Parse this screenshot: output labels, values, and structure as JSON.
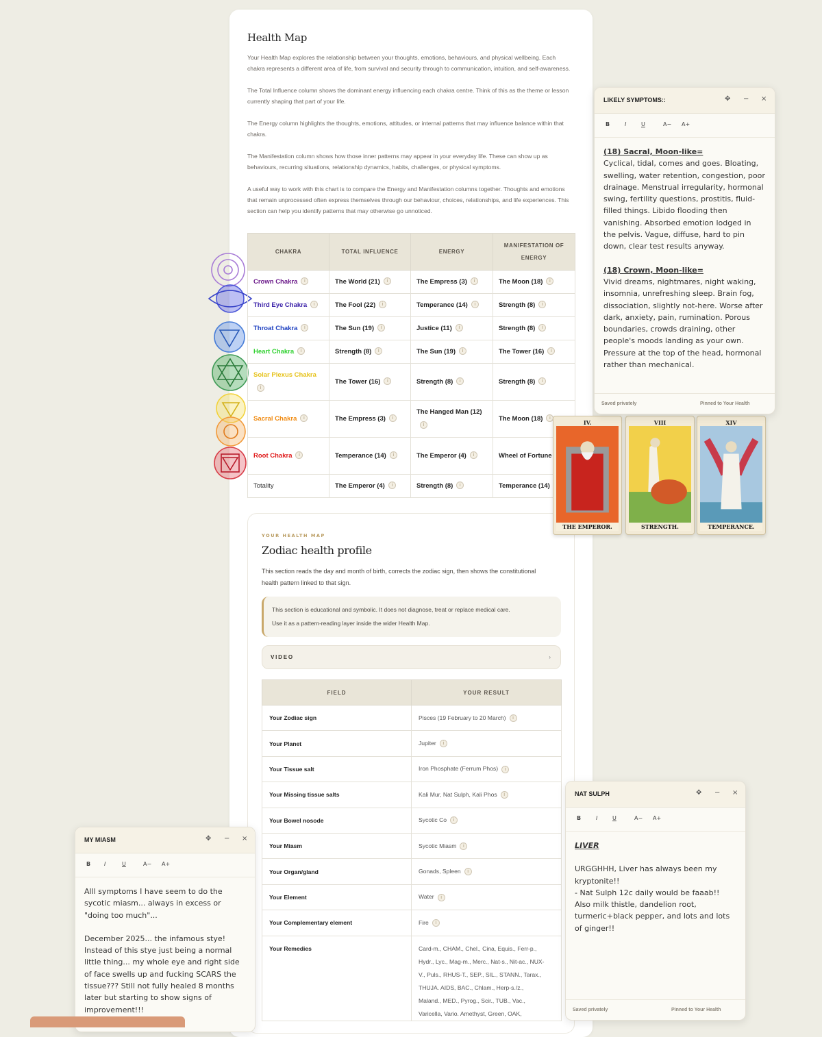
{
  "health_map": {
    "title": "Health Map",
    "paragraphs": [
      "Your Health Map explores the relationship between your thoughts, emotions, behaviours, and physical wellbeing. Each chakra represents a different area of life, from survival and security through to communication, intuition, and self-awareness.",
      "The Total Influence column shows the dominant energy influencing each chakra centre. Think of this as the theme or lesson currently shaping that part of your life.",
      "The Energy column highlights the thoughts, emotions, attitudes, or internal patterns that may influence balance within that chakra.",
      "The Manifestation column shows how those inner patterns may appear in your everyday life. These can show up as behaviours, recurring situations, relationship dynamics, habits, challenges, or physical symptoms.",
      "A useful way to work with this chart is to compare the Energy and Manifestation columns together. Thoughts and emotions that remain unprocessed often express themselves through our behaviour, choices, relationships, and life experiences. This section can help you identify patterns that may otherwise go unnoticed."
    ]
  },
  "chakra_table": {
    "headers": [
      "CHAKRA",
      "TOTAL INFLUENCE",
      "ENERGY",
      "MANIFESTATION OF ENERGY"
    ],
    "rows": [
      {
        "chakra": "Crown Chakra",
        "color": "#6b1a8a",
        "total": "The World (21)",
        "energy": "The Empress (3)",
        "manifestation": "The Moon (18)"
      },
      {
        "chakra": "Third Eye Chakra",
        "color": "#3a20a8",
        "total": "The Fool (22)",
        "energy": "Temperance (14)",
        "manifestation": "Strength (8)"
      },
      {
        "chakra": "Throat Chakra",
        "color": "#1c3fc0",
        "total": "The Sun (19)",
        "energy": "Justice (11)",
        "manifestation": "Strength (8)"
      },
      {
        "chakra": "Heart Chakra",
        "color": "#2fd12f",
        "total": "Strength (8)",
        "energy": "The Sun (19)",
        "manifestation": "The Tower (16)"
      },
      {
        "chakra": "Solar Plexus Chakra",
        "color": "#e6c21a",
        "total": "The Tower (16)",
        "energy": "Strength (8)",
        "manifestation": "Strength (8)"
      },
      {
        "chakra": "Sacral Chakra",
        "color": "#f08a10",
        "total": "The Empress (3)",
        "energy": "The Hanged Man (12)",
        "manifestation": "The Moon (18)"
      },
      {
        "chakra": "Root Chakra",
        "color": "#e01a1a",
        "total": "Temperance (14)",
        "energy": "The Emperor (4)",
        "manifestation": "Wheel of Fortune"
      },
      {
        "chakra": "Totality",
        "color": "#333333",
        "total": "The Emperor (4)",
        "energy": "Strength (8)",
        "manifestation": "Temperance (14)"
      }
    ]
  },
  "chakra_icon_colors": [
    "#a77bd6",
    "#4a55d8",
    "#4a7fd8",
    "#3e9a55",
    "#f2d23a",
    "#f29a3a",
    "#d8404a"
  ],
  "zodiac": {
    "kicker": "YOUR HEALTH MAP",
    "title": "Zodiac health profile",
    "description": "This section reads the day and month of birth, corrects the zodiac sign, then shows the constitutional health pattern linked to that sign.",
    "note_line1": "This section is educational and symbolic. It does not diagnose, treat or replace medical care.",
    "note_line2": "Use it as a pattern-reading layer inside the wider Health Map.",
    "video_label": "VIDEO",
    "table_headers": [
      "FIELD",
      "YOUR RESULT"
    ],
    "rows": [
      {
        "field": "Your Zodiac sign",
        "result": "Pisces (19 February to 20 March)"
      },
      {
        "field": "Your Planet",
        "result": "Jupiter"
      },
      {
        "field": "Your Tissue salt",
        "result": "Iron Phosphate (Ferrum Phos)"
      },
      {
        "field": "Your Missing tissue salts",
        "result": "Kali Mur, Nat Sulph, Kali Phos"
      },
      {
        "field": "Your Bowel nosode",
        "result": "Sycotic Co"
      },
      {
        "field": "Your Miasm",
        "result": "Sycotic Miasm"
      },
      {
        "field": "Your Organ/gland",
        "result": "Gonads, Spleen"
      },
      {
        "field": "Your Element",
        "result": "Water"
      },
      {
        "field": "Your Complementary element",
        "result": "Fire"
      }
    ],
    "remedies_field": "Your Remedies",
    "remedies_lines": [
      "Card-m., CHAM., Chel., Cina, Equis., Ferr-p.,",
      "Hydr., Lyc., Mag-m., Merc., Nat-s., Nit-ac., NUX-",
      "V., Puls., RHUS-T., SEP., SIL., STANN., Tarax.,",
      "THUJA. AIDS, BAC., Chlam., Herp-s./z.,",
      "Maland., MED., Pyrog., Scir., TUB., Vac.,",
      "Varicella, Vario. Amethyst, Green, OAK,"
    ]
  },
  "symptoms_note": {
    "title": "LIKELY SYMPTOMS::",
    "toolbar": {
      "bold": "B",
      "italic": "I",
      "underline": "U",
      "smaller": "A−",
      "larger": "A+"
    },
    "heading1": "(18) Sacral, Moon-like=",
    "text1": "Cyclical, tidal, comes and goes. Bloating, swelling, water retention, congestion, poor drainage. Menstrual irregularity, hormonal swing, fertility questions, prostitis, fluid-filled things. Libido flooding then vanishing. Absorbed emotion lodged in the pelvis. Vague, diffuse, hard to pin down, clear test results anyway.",
    "heading2": "(18) Crown, Moon-like=",
    "text2": "Vivid dreams, nightmares, night waking, insomnia, unrefreshing sleep. Brain fog, dissociation, slightly not-here. Worse after dark, anxiety, pain, rumination. Porous boundaries, crowds draining, other people's moods landing as your own. Pressure at the top of the head, hormonal rather than mechanical.",
    "footer_left": "Saved privately",
    "footer_right": "Pinned to Your Health"
  },
  "miasm_note": {
    "title": "MY MIASM",
    "toolbar": {
      "bold": "B",
      "italic": "I",
      "underline": "U",
      "smaller": "A−",
      "larger": "A+"
    },
    "text1": "Alll symptoms I have seem to do the sycotic miasm... always in excess or \"doing too much\"...",
    "text2": "December 2025... the infamous stye! Instead of this stye just being a normal little thing... my whole eye and right side of face swells up and fucking SCARS the tissue??? Still not fully healed 8 months later but starting to show signs of improvement!!!"
  },
  "natsulph_note": {
    "title": "NAT SULPH",
    "toolbar": {
      "bold": "B",
      "italic": "I",
      "underline": "U",
      "smaller": "A−",
      "larger": "A+"
    },
    "heading": "LIVER",
    "text1": "URGGHHH, Liver has always been my kryptonite!!",
    "text2": "- Nat Sulph 12c daily would be faaab!! Also milk thistle, dandelion root, turmeric+black pepper, and lots and lots of ginger!!",
    "footer_left": "Saved privately",
    "footer_right": "Pinned to Your Health"
  },
  "tarot_cards": [
    {
      "numeral": "IV.",
      "name": "THE EMPEROR."
    },
    {
      "numeral": "VIII",
      "name": "STRENGTH."
    },
    {
      "numeral": "XIV",
      "name": "TEMPERANCE."
    }
  ],
  "icons": {
    "info": "i",
    "move": "✥",
    "minimize": "−",
    "close": "×",
    "chevron": "›"
  }
}
